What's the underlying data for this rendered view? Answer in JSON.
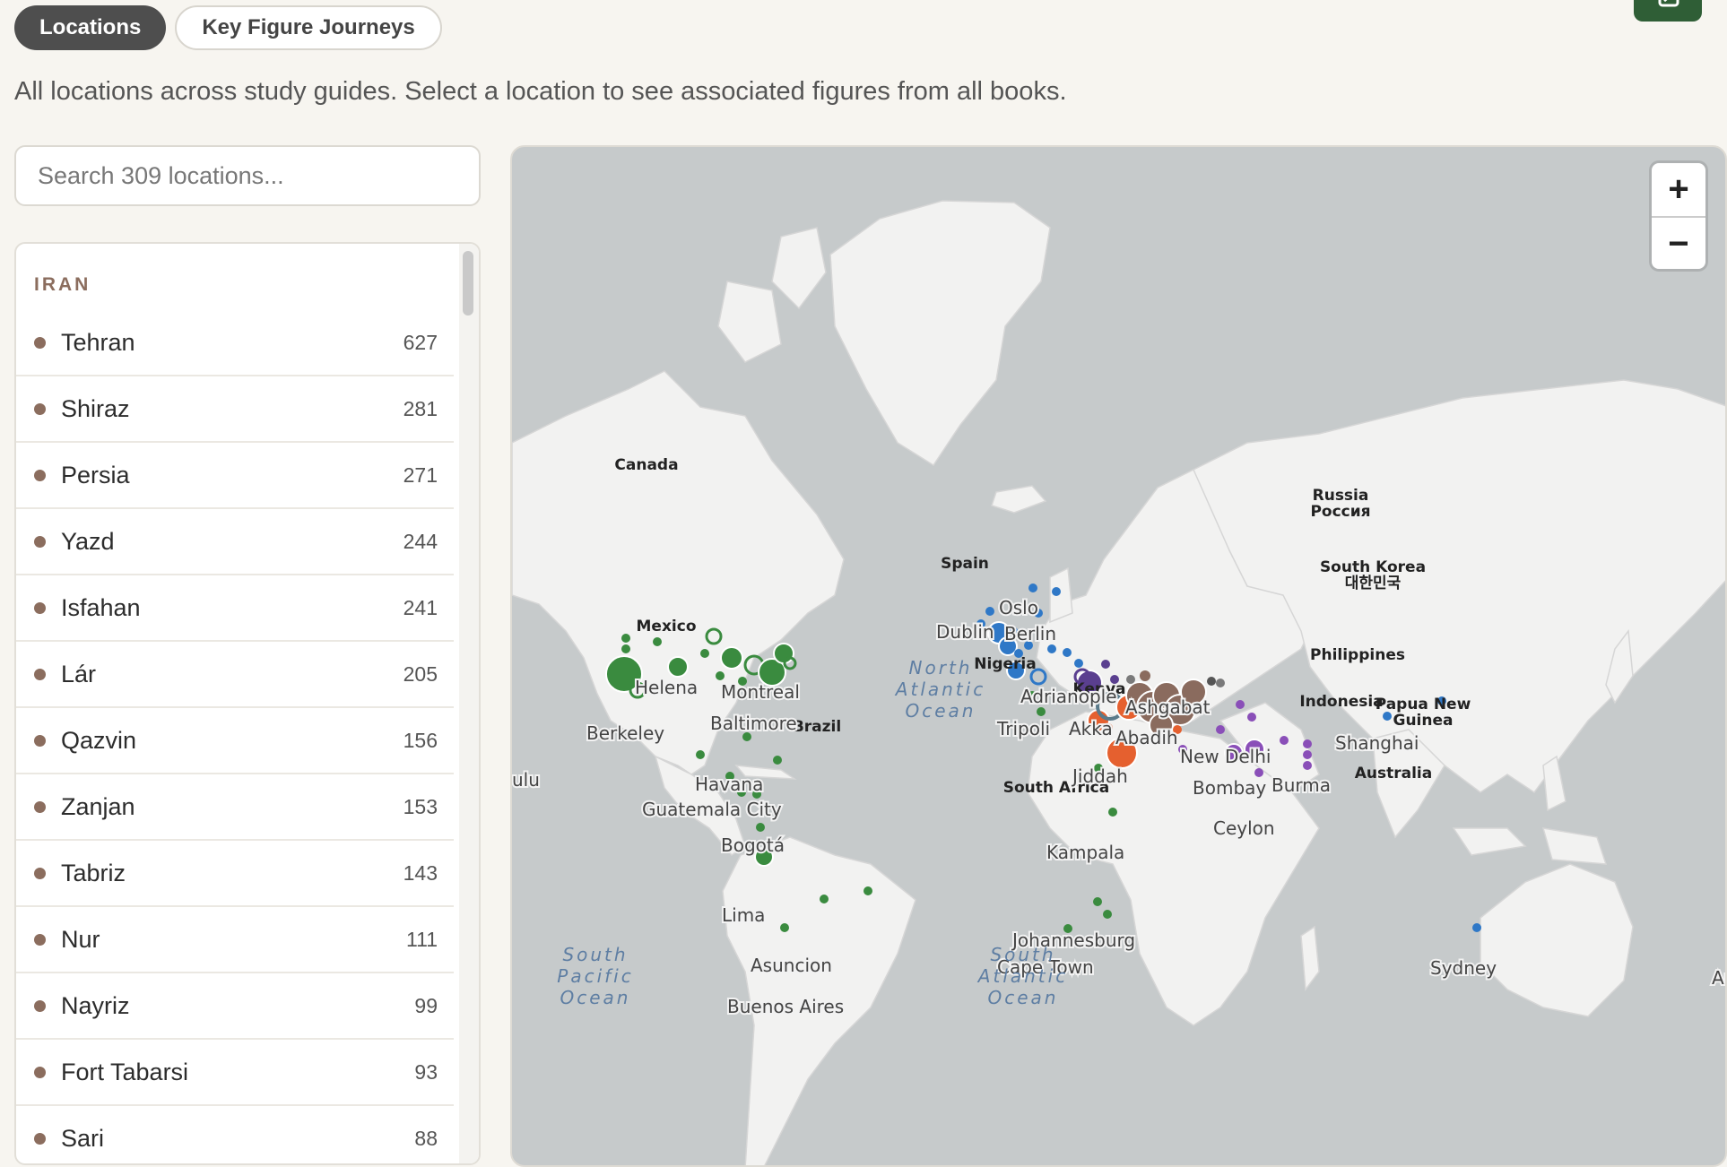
{
  "tabs": [
    {
      "label": "Locations",
      "active": true
    },
    {
      "label": "Key Figure Journeys",
      "active": false
    }
  ],
  "description": "All locations across study guides. Select a location to see associated figures from all books.",
  "search": {
    "placeholder": "Search 309 locations..."
  },
  "list": {
    "group": "IRAN",
    "items": [
      {
        "name": "Tehran",
        "count": "627"
      },
      {
        "name": "Shiraz",
        "count": "281"
      },
      {
        "name": "Persia",
        "count": "271"
      },
      {
        "name": "Yazd",
        "count": "244"
      },
      {
        "name": "Isfahan",
        "count": "241"
      },
      {
        "name": "Lár",
        "count": "205"
      },
      {
        "name": "Qazvin",
        "count": "156"
      },
      {
        "name": "Zanjan",
        "count": "153"
      },
      {
        "name": "Tabriz",
        "count": "143"
      },
      {
        "name": "Nur",
        "count": "111"
      },
      {
        "name": "Nayriz",
        "count": "99"
      },
      {
        "name": "Fort Tabarsi",
        "count": "93"
      },
      {
        "name": "Sari",
        "count": "88"
      }
    ]
  },
  "map": {
    "zoom_in": "+",
    "zoom_out": "−",
    "countries": {
      "canada": "Canada",
      "russia": "Russia",
      "russia_native": "Россия",
      "mexico": "Mexico",
      "spain": "Spain",
      "brazil": "Brazil",
      "nigeria": "Nigeria",
      "kenya": "Kenya",
      "south_africa": "South Africa",
      "south_korea": "South Korea",
      "south_korea_native": "대한민국",
      "philippines": "Philippines",
      "indonesia": "Indonesia",
      "png1": "Papua New",
      "png2": "Guinea",
      "australia": "Australia"
    },
    "cities": {
      "helena": "Helena",
      "montreal": "Montreal",
      "baltimore": "Baltimore",
      "berkeley": "Berkeley",
      "havana": "Havana",
      "guatemala": "Guatemala City",
      "bogota": "Bogotá",
      "lima": "Lima",
      "asuncion": "Asuncion",
      "buenos_aires": "Buenos Aires",
      "oslo": "Oslo",
      "dublin": "Dublin",
      "berlin": "Berlin",
      "adrianople": "Adrianople",
      "tripoli": "Tripoli",
      "akka": "Akka",
      "abadih": "Abadih",
      "ashgabat": "Ashgabat",
      "jiddah": "Jiddah",
      "new_delhi": "New Delhi",
      "bombay": "Bombay",
      "burma": "Burma",
      "shanghai": "Shanghai",
      "ceylon": "Ceylon",
      "kampala": "Kampala",
      "johannesburg": "Johannesburg",
      "cape_town": "Cape Town",
      "sydney": "Sydney",
      "ulu": "ulu",
      "au": "Au"
    },
    "oceans": {
      "north_atlantic": [
        "North",
        "Atlantic",
        "Ocean"
      ],
      "south_pacific": [
        "South",
        "Pacific",
        "Ocean"
      ],
      "south_atlantic": [
        "South",
        "Atlantic",
        "Ocean"
      ]
    },
    "colors": {
      "americas": "#3a8b3f",
      "europe": "#2f78c7",
      "iran": "#8a6b5e",
      "middle_east": "#e5602f",
      "ottoman": "#5a3f8f",
      "india": "#8a4fb8",
      "gray": "#7a7a7a"
    }
  }
}
